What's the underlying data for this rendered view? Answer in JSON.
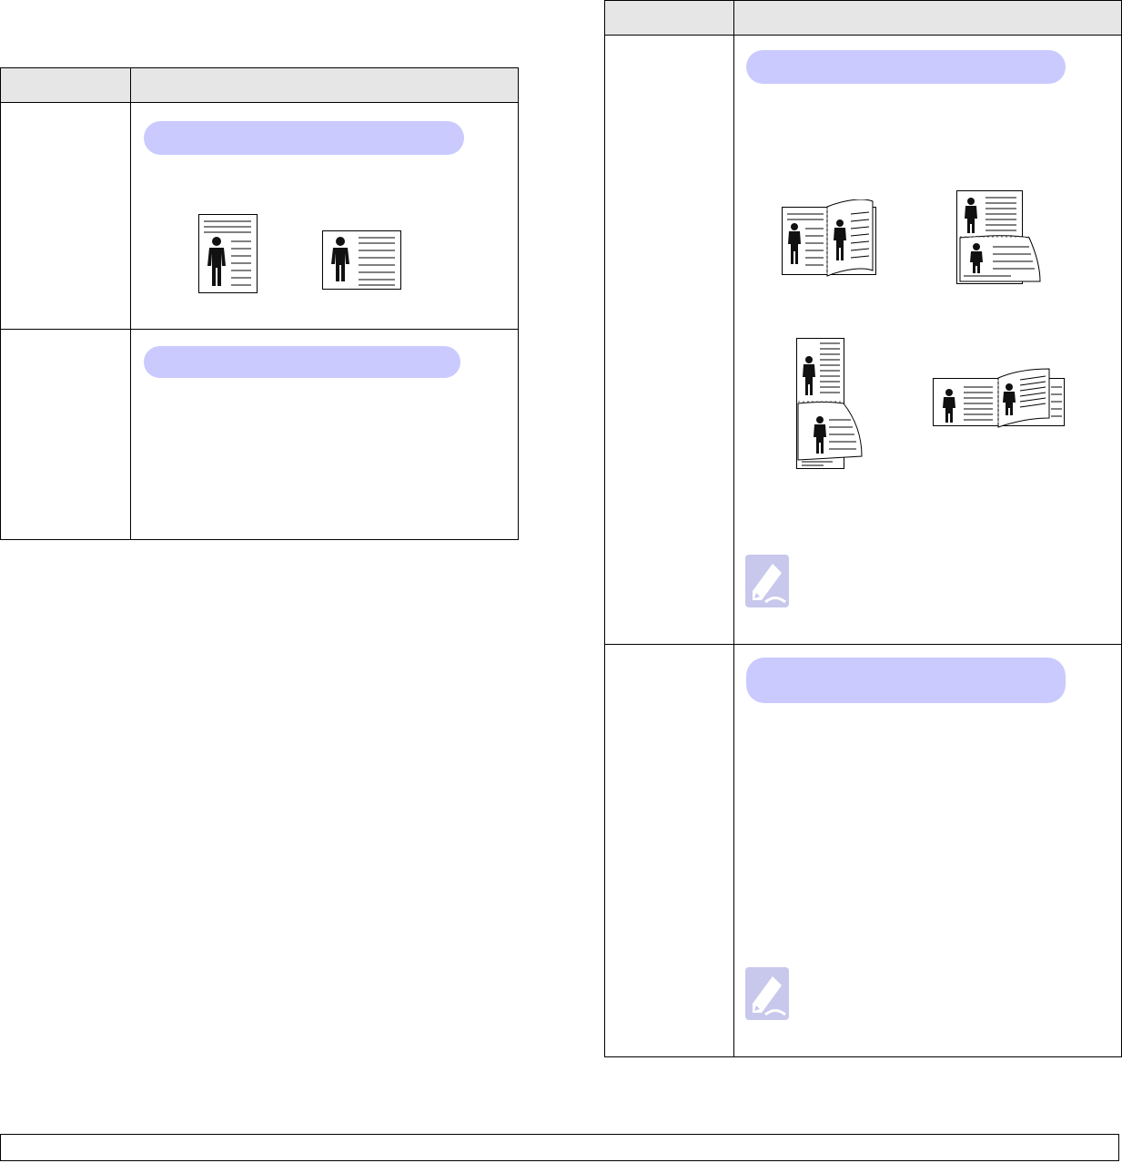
{
  "left_table": {
    "header": [
      "",
      ""
    ],
    "rows": [
      {
        "label": "",
        "pill_text": ""
      },
      {
        "label": "",
        "pill_text": ""
      }
    ]
  },
  "right_table": {
    "header": [
      "",
      ""
    ],
    "rows": [
      {
        "label": "",
        "pill_text": ""
      },
      {
        "label": "",
        "pill_text": ""
      }
    ]
  },
  "icons": {
    "orientation_portrait": "portrait-page-icon",
    "orientation_landscape": "landscape-page-icon",
    "duplex_long_edge_portrait": "duplex-long-edge-portrait-icon",
    "duplex_short_edge_portrait": "duplex-short-edge-portrait-icon",
    "duplex_long_edge_landscape": "duplex-long-edge-landscape-icon",
    "duplex_short_edge_landscape": "duplex-short-edge-landscape-icon",
    "note": "note-pencil-icon"
  },
  "colors": {
    "pill": "#cacaff",
    "header_bg": "#e6e6e6",
    "note_icon": "#c8c8ec"
  }
}
